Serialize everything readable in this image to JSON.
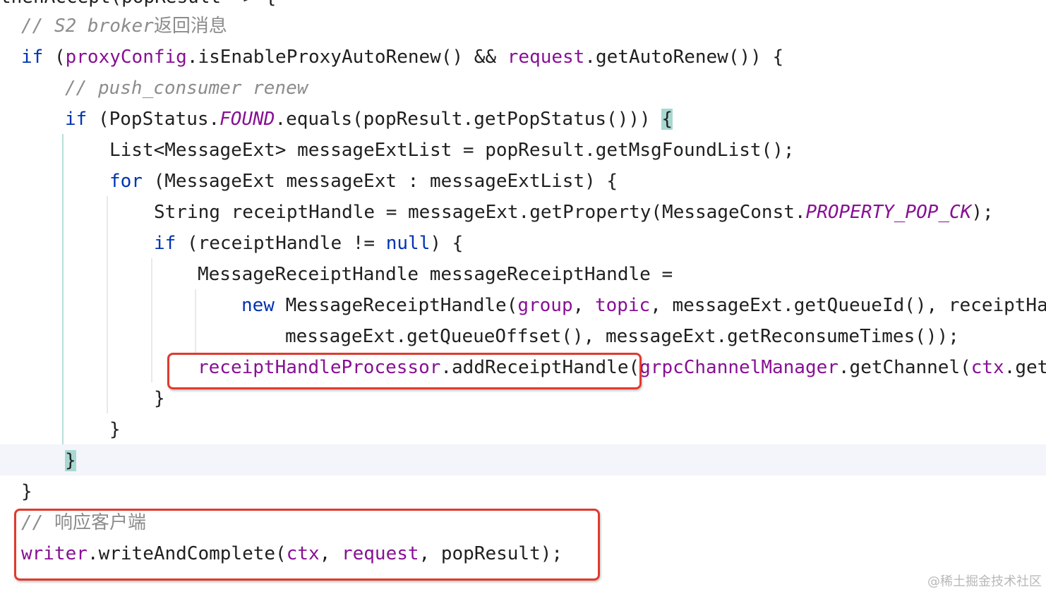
{
  "editor": {
    "lines": [
      {
        "id": "l0",
        "tokens": [
          {
            "t": "thenAccept(popResult -> {",
            "c": "plain"
          }
        ]
      },
      {
        "id": "l1",
        "tokens": [
          {
            "t": "// S2 broker",
            "c": "comment"
          },
          {
            "t": "返回消息",
            "c": "comment-cjk"
          }
        ]
      },
      {
        "id": "l2",
        "tokens": [
          {
            "t": "if",
            "c": "kw"
          },
          {
            "t": " (",
            "c": "plain"
          },
          {
            "t": "proxyConfig",
            "c": "field"
          },
          {
            "t": ".isEnableProxyAutoRenew() && ",
            "c": "plain"
          },
          {
            "t": "request",
            "c": "field"
          },
          {
            "t": ".getAutoRenew()) {",
            "c": "plain"
          }
        ]
      },
      {
        "id": "l3",
        "tokens": [
          {
            "t": "// push_consumer renew",
            "c": "comment"
          }
        ]
      },
      {
        "id": "l4",
        "tokens": [
          {
            "t": "if",
            "c": "kw"
          },
          {
            "t": " (PopStatus.",
            "c": "plain"
          },
          {
            "t": "FOUND",
            "c": "static"
          },
          {
            "t": ".equals(popResult.getPopStatus())) ",
            "c": "plain"
          },
          {
            "t": "{",
            "c": "brace"
          }
        ]
      },
      {
        "id": "l5",
        "tokens": [
          {
            "t": "List<MessageExt> messageExtList = popResult.getMsgFoundList();",
            "c": "plain"
          }
        ]
      },
      {
        "id": "l6",
        "tokens": [
          {
            "t": "for",
            "c": "kw"
          },
          {
            "t": " (MessageExt messageExt : messageExtList) {",
            "c": "plain"
          }
        ]
      },
      {
        "id": "l7",
        "tokens": [
          {
            "t": "String receiptHandle = messageExt.getProperty(MessageConst.",
            "c": "plain"
          },
          {
            "t": "PROPERTY_POP_CK",
            "c": "static"
          },
          {
            "t": ");",
            "c": "plain"
          }
        ]
      },
      {
        "id": "l8",
        "tokens": [
          {
            "t": "if",
            "c": "kw"
          },
          {
            "t": " (receiptHandle != ",
            "c": "plain"
          },
          {
            "t": "null",
            "c": "kw"
          },
          {
            "t": ") {",
            "c": "plain"
          }
        ]
      },
      {
        "id": "l9",
        "tokens": [
          {
            "t": "MessageReceiptHandle messageReceiptHandle =",
            "c": "plain"
          }
        ]
      },
      {
        "id": "l10",
        "tokens": [
          {
            "t": "new",
            "c": "kw"
          },
          {
            "t": " MessageReceiptHandle(",
            "c": "plain"
          },
          {
            "t": "group",
            "c": "field"
          },
          {
            "t": ", ",
            "c": "plain"
          },
          {
            "t": "topic",
            "c": "field"
          },
          {
            "t": ", messageExt.getQueueId(), receiptHa",
            "c": "plain"
          }
        ]
      },
      {
        "id": "l11",
        "tokens": [
          {
            "t": "messageExt.getQueueOffset(), messageExt.getReconsumeTimes());",
            "c": "plain"
          }
        ]
      },
      {
        "id": "l12",
        "tokens": [
          {
            "t": "receiptHandleProcessor",
            "c": "field"
          },
          {
            "t": ".addReceiptHandle(",
            "c": "plain"
          },
          {
            "t": "grpcChannelManager",
            "c": "field"
          },
          {
            "t": ".getChannel(",
            "c": "plain"
          },
          {
            "t": "ctx",
            "c": "field"
          },
          {
            "t": ".get",
            "c": "plain"
          }
        ]
      },
      {
        "id": "l13",
        "tokens": [
          {
            "t": "}",
            "c": "plain"
          }
        ]
      },
      {
        "id": "l14",
        "tokens": [
          {
            "t": "}",
            "c": "plain"
          }
        ]
      },
      {
        "id": "l15",
        "tokens": [
          {
            "t": "}",
            "c": "brace"
          }
        ]
      },
      {
        "id": "l16",
        "tokens": [
          {
            "t": "}",
            "c": "plain"
          }
        ]
      },
      {
        "id": "l17",
        "tokens": [
          {
            "t": "// ",
            "c": "comment"
          },
          {
            "t": "响应客户端",
            "c": "comment-cjk"
          }
        ]
      },
      {
        "id": "l18",
        "tokens": [
          {
            "t": "writer",
            "c": "field"
          },
          {
            "t": ".writeAndComplete(",
            "c": "plain"
          },
          {
            "t": "ctx",
            "c": "field"
          },
          {
            "t": ", ",
            "c": "plain"
          },
          {
            "t": "request",
            "c": "field"
          },
          {
            "t": ", popResult);",
            "c": "plain"
          }
        ]
      }
    ]
  },
  "watermark": "@稀土掘金技术社区",
  "colors": {
    "keyword": "#0033b3",
    "field": "#871094",
    "comment": "#8c8c8c",
    "highlight_box": "#e03a2e",
    "brace_match": "#a8d8d2"
  }
}
